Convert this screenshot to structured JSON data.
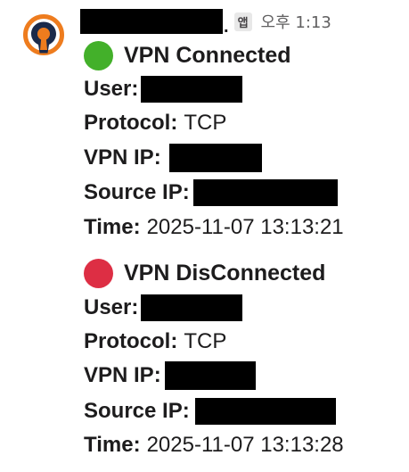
{
  "message": {
    "time": "오후 1:13",
    "app_badge": "앱",
    "sender_dot": ".",
    "avatar_icon": "openvpn-logo-icon",
    "colors": {
      "avatar_orange": "#ee7c1e",
      "avatar_navy": "#1b2a4a",
      "connected_green": "#43b02a",
      "disconnected_red": "#dd2e44"
    }
  },
  "events": [
    {
      "status_icon": "green-circle-icon",
      "title": "VPN Connected",
      "user_label": "User:",
      "protocol_label": "Protocol:",
      "protocol_value": "TCP",
      "vpn_ip_label": "VPN IP:",
      "source_ip_label": "Source IP:",
      "time_label": "Time:",
      "time_value": "2025-11-07 13:13:21"
    },
    {
      "status_icon": "red-circle-icon",
      "title": "VPN DisConnected",
      "user_label": "User:",
      "protocol_label": "Protocol:",
      "protocol_value": "TCP",
      "vpn_ip_label": "VPN IP:",
      "source_ip_label": "Source IP:",
      "time_label": "Time:",
      "time_value": "2025-11-07 13:13:28"
    }
  ]
}
